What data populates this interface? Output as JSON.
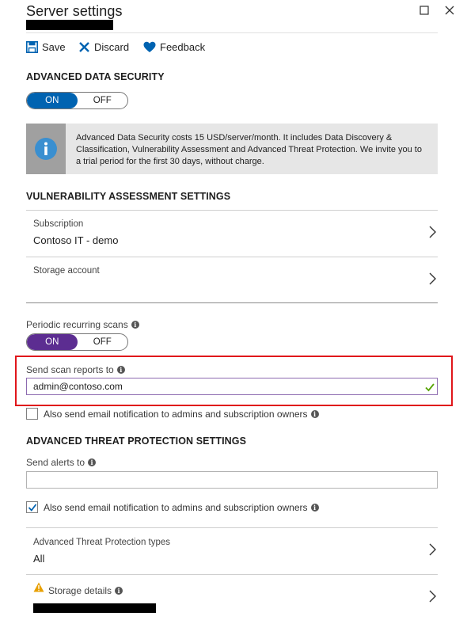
{
  "header": {
    "title": "Server settings",
    "window_buttons": [
      "restore",
      "close"
    ]
  },
  "toolbar": {
    "save_label": "Save",
    "discard_label": "Discard",
    "feedback_label": "Feedback"
  },
  "advanced_data_security": {
    "heading": "ADVANCED DATA SECURITY",
    "toggle": {
      "on_label": "ON",
      "off_label": "OFF",
      "selected": "ON"
    },
    "info_text": "Advanced Data Security costs 15 USD/server/month. It includes Data Discovery & Classification, Vulnerability Assessment and Advanced Threat Protection. We invite you to a trial period for the first 30 days, without charge."
  },
  "vulnerability_assessment": {
    "heading": "VULNERABILITY ASSESSMENT SETTINGS",
    "subscription": {
      "label": "Subscription",
      "value": "Contoso IT - demo"
    },
    "storage_account": {
      "label": "Storage account",
      "value": ""
    },
    "periodic_scans": {
      "label": "Periodic recurring scans",
      "toggle": {
        "on_label": "ON",
        "off_label": "OFF",
        "selected": "ON"
      }
    },
    "send_scan_reports": {
      "label": "Send scan reports to",
      "value": "admin@contoso.com"
    },
    "email_admins": {
      "label": "Also send email notification to admins and subscription owners",
      "checked": false
    }
  },
  "threat_protection": {
    "heading": "ADVANCED THREAT PROTECTION SETTINGS",
    "send_alerts": {
      "label": "Send alerts to",
      "value": ""
    },
    "email_admins": {
      "label": "Also send email notification to admins and subscription owners",
      "checked": true
    },
    "types": {
      "label": "Advanced Threat Protection types",
      "value": "All"
    },
    "storage_details": {
      "label": "Storage details",
      "icon": "warning-icon"
    }
  },
  "colors": {
    "accent_blue": "#0063b1",
    "toggle_purple": "#5c2d91",
    "highlight_red": "#e0161b",
    "valid_green": "#57a300",
    "warning_orange": "#e8a000"
  }
}
